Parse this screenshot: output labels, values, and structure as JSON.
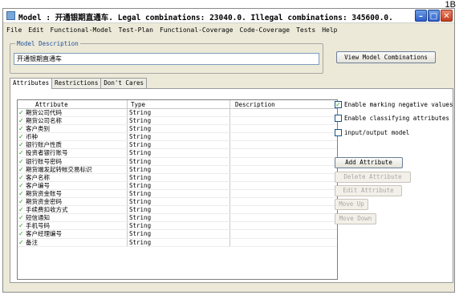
{
  "corner_text": "1B",
  "window": {
    "title": "Model : 开通银期直通车. Legal combinations: 23040.0. Illegal combinations: 345600.0."
  },
  "menu": [
    "File",
    "Edit",
    "Functional-Model",
    "Test-Plan",
    "Functional-Coverage",
    "Code-Coverage",
    "Tests",
    "Help"
  ],
  "model_description": {
    "legend": "Model Description",
    "value": "开通银期直通车"
  },
  "view_button": "View Model Combinations",
  "tabs": [
    "Attributes",
    "Restrictions",
    "Don't Cares"
  ],
  "table": {
    "headers": [
      "Attribute",
      "Type",
      "Description"
    ],
    "rows": [
      {
        "name": "期货公司代码",
        "type": "String",
        "description": ""
      },
      {
        "name": "期货公司名称",
        "type": "String",
        "description": ""
      },
      {
        "name": "客户类别",
        "type": "String",
        "description": ""
      },
      {
        "name": "币种",
        "type": "String",
        "description": ""
      },
      {
        "name": "银行账户性质",
        "type": "String",
        "description": ""
      },
      {
        "name": "投资者银行账号",
        "type": "String",
        "description": ""
      },
      {
        "name": "银行账号密码",
        "type": "String",
        "description": ""
      },
      {
        "name": "期货端发起转帐交易标识",
        "type": "String",
        "description": ""
      },
      {
        "name": "客户名称",
        "type": "String",
        "description": ""
      },
      {
        "name": "客户编号",
        "type": "String",
        "description": ""
      },
      {
        "name": "期货资金账号",
        "type": "String",
        "description": ""
      },
      {
        "name": "期货资金密码",
        "type": "String",
        "description": ""
      },
      {
        "name": "手续费扣收方式",
        "type": "String",
        "description": ""
      },
      {
        "name": "短信通知",
        "type": "String",
        "description": ""
      },
      {
        "name": "手机号码",
        "type": "String",
        "description": ""
      },
      {
        "name": "客户经理编号",
        "type": "String",
        "description": ""
      },
      {
        "name": "备注",
        "type": "String",
        "description": ""
      }
    ]
  },
  "options": {
    "enable_negative": {
      "label": "Enable marking negative values",
      "checked": true
    },
    "enable_classifying": {
      "label": "Enable classifying attributes",
      "checked": false
    },
    "io_model": {
      "label": "input/output model",
      "checked": false
    }
  },
  "buttons": {
    "add": "Add Attribute",
    "delete": "Delete Attribute",
    "edit": "Edit Attribute",
    "move_up": "Move Up",
    "move_down": "Move Down"
  }
}
